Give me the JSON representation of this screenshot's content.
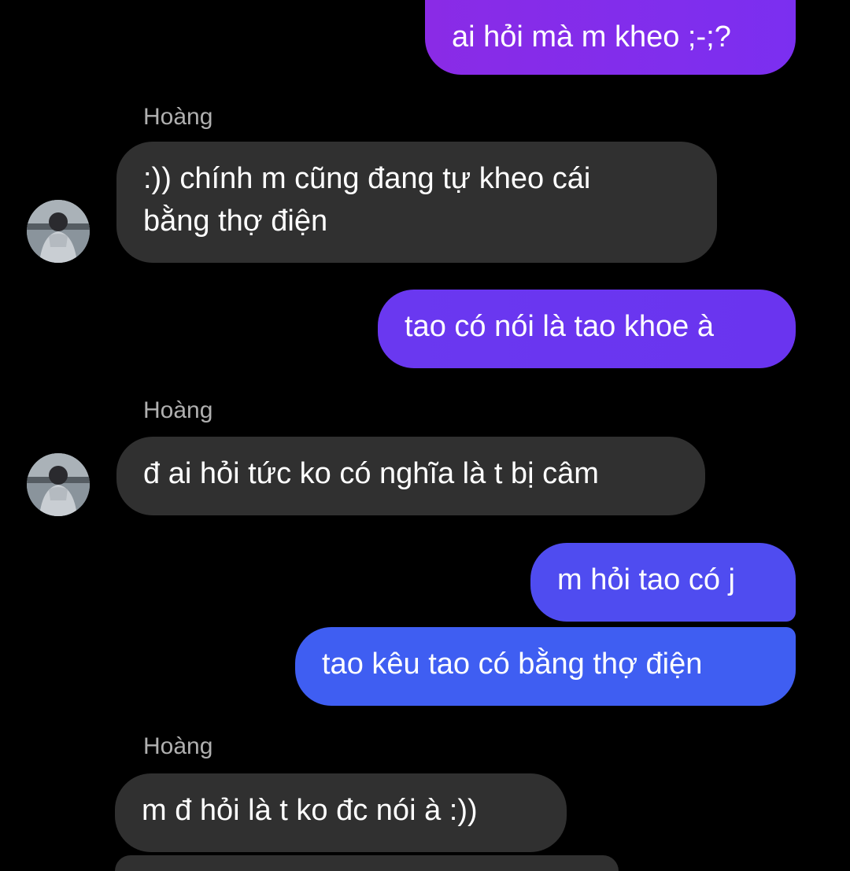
{
  "conversation": {
    "messages": [
      {
        "direction": "outgoing",
        "text": "ai hỏi mà m kheo ;-;?"
      },
      {
        "direction": "incoming",
        "sender": "Hoàng",
        "text": ":)) chính m cũng đang tự kheo cái\nbằng thợ điện"
      },
      {
        "direction": "outgoing",
        "text": "tao có nói là tao khoe à"
      },
      {
        "direction": "incoming",
        "sender": "Hoàng",
        "text": "đ ai hỏi tức ko có nghĩa là t bị câm"
      },
      {
        "direction": "outgoing",
        "text": "m hỏi tao có j"
      },
      {
        "direction": "outgoing",
        "text": "tao kêu tao có bằng thợ điện"
      },
      {
        "direction": "incoming",
        "sender": "Hoàng",
        "text": "m đ hỏi là t ko đc nói à :))"
      }
    ]
  },
  "colors": {
    "background": "#000000",
    "incoming_bubble": "#303030",
    "outgoing_gradient": [
      "#8a2be6",
      "#6a38f0",
      "#4f4cf0",
      "#3f5ef2"
    ],
    "sender_name": "#b0b0b0"
  },
  "icons": {
    "avatar": "contact-avatar-photo"
  }
}
